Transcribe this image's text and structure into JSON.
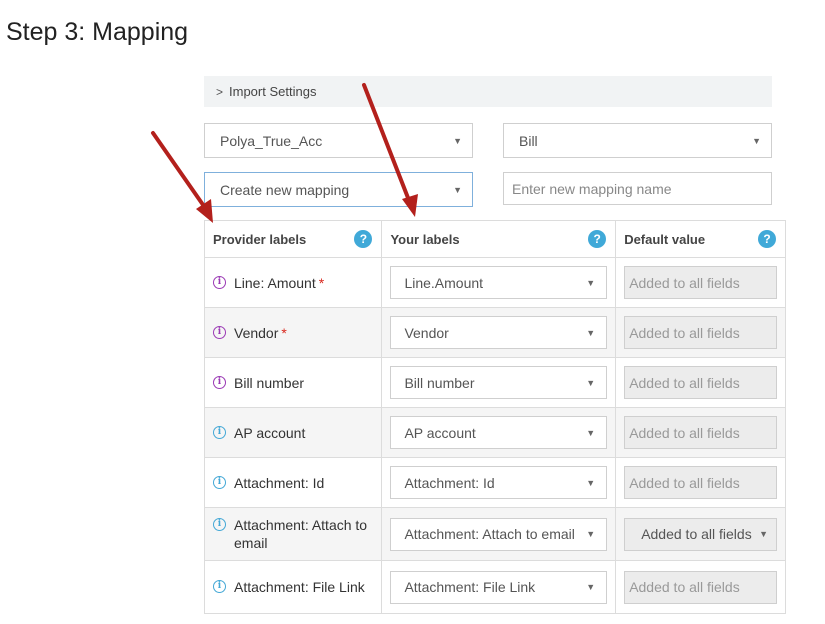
{
  "page": {
    "step_title": "Step 3: Mapping"
  },
  "import_settings": {
    "label": "Import Settings"
  },
  "selectors": {
    "account": "Polya_True_Acc",
    "entity": "Bill",
    "mapping": "Create new mapping",
    "mapping_name_placeholder": "Enter new mapping name"
  },
  "table": {
    "headers": {
      "provider": "Provider labels",
      "yours": "Your labels",
      "default": "Default value"
    },
    "rows": [
      {
        "provider": "Line: Amount",
        "required": "*",
        "label": "Line.Amount",
        "default": "Added to all fields",
        "icon_color": "purple"
      },
      {
        "provider": "Vendor",
        "required": "*",
        "label": "Vendor",
        "default": "Added to all fields",
        "icon_color": "purple"
      },
      {
        "provider": "Bill number",
        "required": "",
        "label": "Bill number",
        "default": "Added to all fields",
        "icon_color": "purple"
      },
      {
        "provider": "AP account",
        "required": "",
        "label": "AP account",
        "default": "Added to all fields",
        "icon_color": "blue"
      },
      {
        "provider": "Attachment: Id",
        "required": "",
        "label": "Attachment: Id",
        "default": "Added to all fields",
        "icon_color": "blue"
      },
      {
        "provider": "Attachment: Attach to email",
        "required": "",
        "label": "Attachment: Attach to email",
        "default": "Added to all fields",
        "icon_color": "blue"
      },
      {
        "provider": "Attachment: File Link",
        "required": "",
        "label": "Attachment: File Link",
        "default": "Added to all fields",
        "icon_color": "blue"
      }
    ]
  },
  "colors": {
    "annotation_arrow": "#b3201c",
    "help_icon": "#40a9d8",
    "info_purple": "#9b3bb5",
    "info_blue": "#44a8d6",
    "required": "#d9261c"
  },
  "icons": {
    "chevron": "chevron-right-icon",
    "caret": "caret-down-icon",
    "help": "question-circle-icon",
    "info": "info-circle-icon"
  }
}
